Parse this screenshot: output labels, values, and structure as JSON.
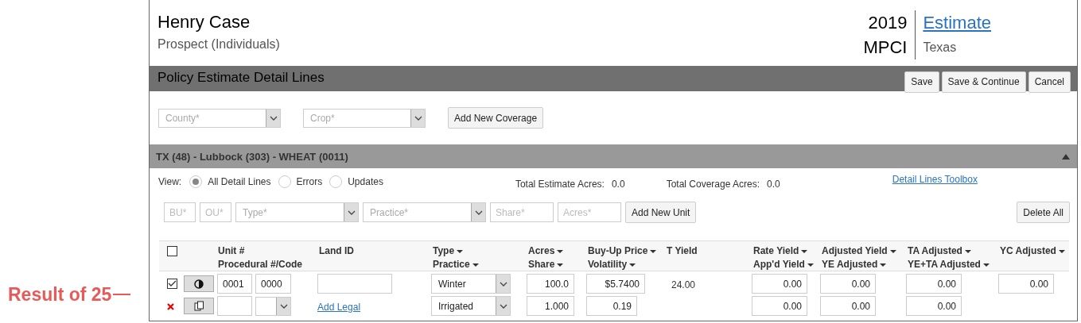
{
  "annotation": {
    "text": "Result of 25"
  },
  "header": {
    "name": "Henry Case",
    "subtitle": "Prospect (Individuals)",
    "year": "2019",
    "program": "MPCI",
    "link": "Estimate",
    "state": "Texas"
  },
  "toolbar": {
    "title": "Policy Estimate Detail Lines",
    "buttons": [
      "Save",
      "Save & Continue",
      "Cancel"
    ]
  },
  "coverage": {
    "fields": [
      {
        "placeholder": "County*"
      },
      {
        "placeholder": "Crop*"
      }
    ],
    "button": "Add New Coverage"
  },
  "section": {
    "title": "TX (48) - Lubbock (303) - WHEAT (0011)",
    "expanded": true
  },
  "view": {
    "label": "View:",
    "options": [
      {
        "label": "All Detail Lines",
        "selected": true
      },
      {
        "label": "Errors",
        "selected": false
      },
      {
        "label": "Updates",
        "selected": false
      }
    ]
  },
  "totals": [
    {
      "label": "Total Estimate Acres:",
      "value": "0.0"
    },
    {
      "label": "Total Coverage Acres:",
      "value": "0.0"
    }
  ],
  "toolbox_link": "Detail Lines Toolbox",
  "unit_form": {
    "fields": [
      {
        "kind": "text",
        "placeholder": "BU*"
      },
      {
        "kind": "text",
        "placeholder": "OU*"
      },
      {
        "kind": "select",
        "placeholder": "Type*"
      },
      {
        "kind": "select",
        "placeholder": "Practice*"
      },
      {
        "kind": "text",
        "placeholder": "Share*"
      },
      {
        "kind": "text",
        "placeholder": "Acres*"
      }
    ],
    "add_button": "Add New Unit",
    "delete_button": "Delete All"
  },
  "table": {
    "select_all": false,
    "columns": [
      {
        "lines": [
          {
            "label": "Unit #",
            "sortable": false
          },
          {
            "label": "Procedural #/Code",
            "sortable": false
          }
        ]
      },
      {
        "lines": [
          {
            "label": "Land ID",
            "sortable": false
          }
        ]
      },
      {
        "lines": [
          {
            "label": "Type",
            "sortable": true
          },
          {
            "label": "Practice",
            "sortable": true
          }
        ]
      },
      {
        "lines": [
          {
            "label": "Acres",
            "sortable": true
          },
          {
            "label": "Share",
            "sortable": true
          }
        ]
      },
      {
        "lines": [
          {
            "label": "Buy-Up Price",
            "sortable": true
          },
          {
            "label": "Volatility",
            "sortable": true
          }
        ]
      },
      {
        "lines": [
          {
            "label": "T Yield",
            "sortable": false
          }
        ]
      },
      {
        "lines": [
          {
            "label": "Rate Yield",
            "sortable": true
          },
          {
            "label": "App'd Yield",
            "sortable": true
          }
        ]
      },
      {
        "lines": [
          {
            "label": "Adjusted Yield",
            "sortable": true
          },
          {
            "label": "YE Adjusted",
            "sortable": true
          }
        ]
      },
      {
        "lines": [
          {
            "label": "TA Adjusted",
            "sortable": true
          },
          {
            "label": "YE+TA Adjusted",
            "sortable": true
          }
        ]
      },
      {
        "lines": [
          {
            "label": "YC Adjusted",
            "sortable": true
          }
        ]
      }
    ],
    "rows": [
      {
        "checked": true,
        "error": true,
        "unit": "0001",
        "procedural": "0000",
        "add_legal": "Add Legal",
        "type": "Winter",
        "practice": "Irrigated",
        "acres": "100.0",
        "share": "1.000",
        "buy_up_price": "$5.7400",
        "volatility": "0.19",
        "t_yield": "24.00",
        "rate_yield": "0.00",
        "appd_yield": "0.00",
        "adjusted_yield": "0.00",
        "ye_adjusted": "0.00",
        "ta_adjusted": "0.00",
        "ye_ta_adjusted": "0.00",
        "yc_adjusted": "0.00"
      }
    ]
  }
}
